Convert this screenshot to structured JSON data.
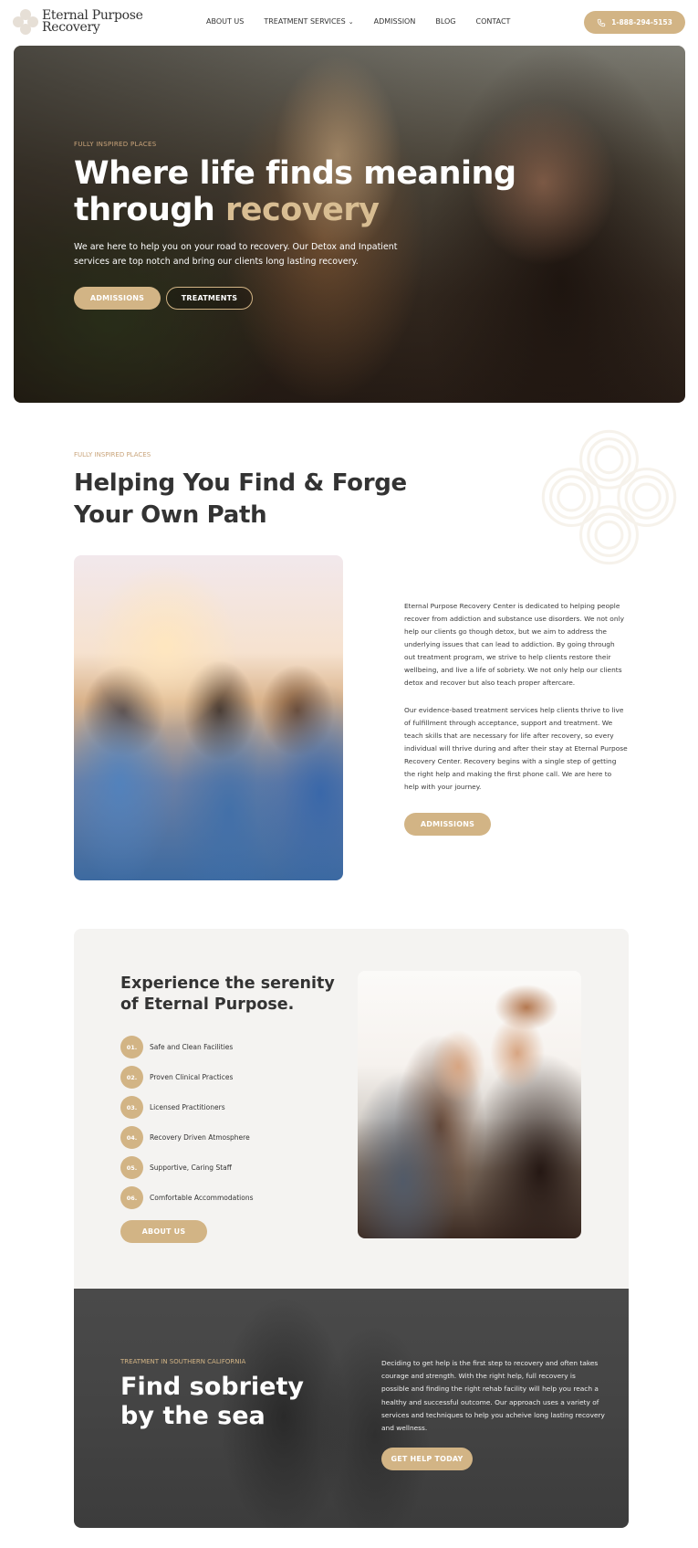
{
  "header": {
    "logo_line1": "Eternal Purpose",
    "logo_line2": "Recovery",
    "nav": [
      {
        "label": "ABOUT US"
      },
      {
        "label": "TREATMENT SERVICES",
        "has_dropdown": true
      },
      {
        "label": "ADMISSION"
      },
      {
        "label": "BLOG"
      },
      {
        "label": "CONTACT"
      }
    ],
    "chevron": "⌄",
    "phone": "1-888-294-5153",
    "phone_icon": "phone-icon"
  },
  "hero": {
    "eyebrow": "FULLY INSPIRED PLACES",
    "title_line1": "Where life finds meaning",
    "title_line2_plain": "through ",
    "title_line2_accent": "recovery",
    "description": "We are here to help you on your road to recovery. Our Detox and Inpatient services are top notch and bring our clients long lasting recovery.",
    "primary_button": "ADMISSIONS",
    "secondary_button": "TREATMENTS"
  },
  "about": {
    "eyebrow": "FULLY INSPIRED PLACES",
    "title_line1": "Helping You Find & Forge",
    "title_line2": "Your Own Path",
    "paragraph1": "Eternal Purpose Recovery Center is dedicated to helping people recover from addiction and substance use disorders. We not only help our clients go though detox, but we aim to address the underlying issues that can lead to addiction. By going through out treatment program, we strive to help clients restore their wellbeing, and live a life of sobriety. We not only help our clients detox and recover but also teach proper aftercare.",
    "paragraph2": "Our evidence-based treatment services help clients thrive to live of fulfillment through acceptance, support and treatment. We teach skills that are necessary for life after recovery, so every individual will thrive during and after their stay at Eternal Purpose Recovery Center. Recovery begins with a single step of getting the right help and making the first phone call.  We are here to help with your journey.",
    "button": "ADMISSIONS"
  },
  "serenity": {
    "title_line1": "Experience the serenity",
    "title_line2": "of Eternal Purpose.",
    "features": [
      {
        "num": "01.",
        "label": "Safe and Clean Facilities"
      },
      {
        "num": "02.",
        "label": "Proven Clinical Practices"
      },
      {
        "num": "03.",
        "label": "Licensed Practitioners"
      },
      {
        "num": "04.",
        "label": "Recovery Driven Atmosphere"
      },
      {
        "num": "05.",
        "label": "Supportive, Caring Staff"
      },
      {
        "num": "06.",
        "label": "Comfortable Accommodations"
      }
    ],
    "button": "ABOUT US"
  },
  "sea": {
    "eyebrow": "TREATMENT IN SOUTHERN CALIFORNIA",
    "title_line1": "Find sobriety",
    "title_line2": "by the sea",
    "description": "Deciding to get help is the first step to recovery and often takes courage and strength. With the right help, full recovery is possible and finding the right rehab facility will help you reach a healthy and successful outcome. Our approach uses a variety of services and techniques to help you acheive long lasting recovery and wellness.",
    "button": "GET HELP TODAY"
  },
  "colors": {
    "accent": "#d2b485",
    "eyebrow": "#c9a47a",
    "text": "#333333",
    "panel": "#f4f3f1",
    "dark_panel": "#444444"
  }
}
